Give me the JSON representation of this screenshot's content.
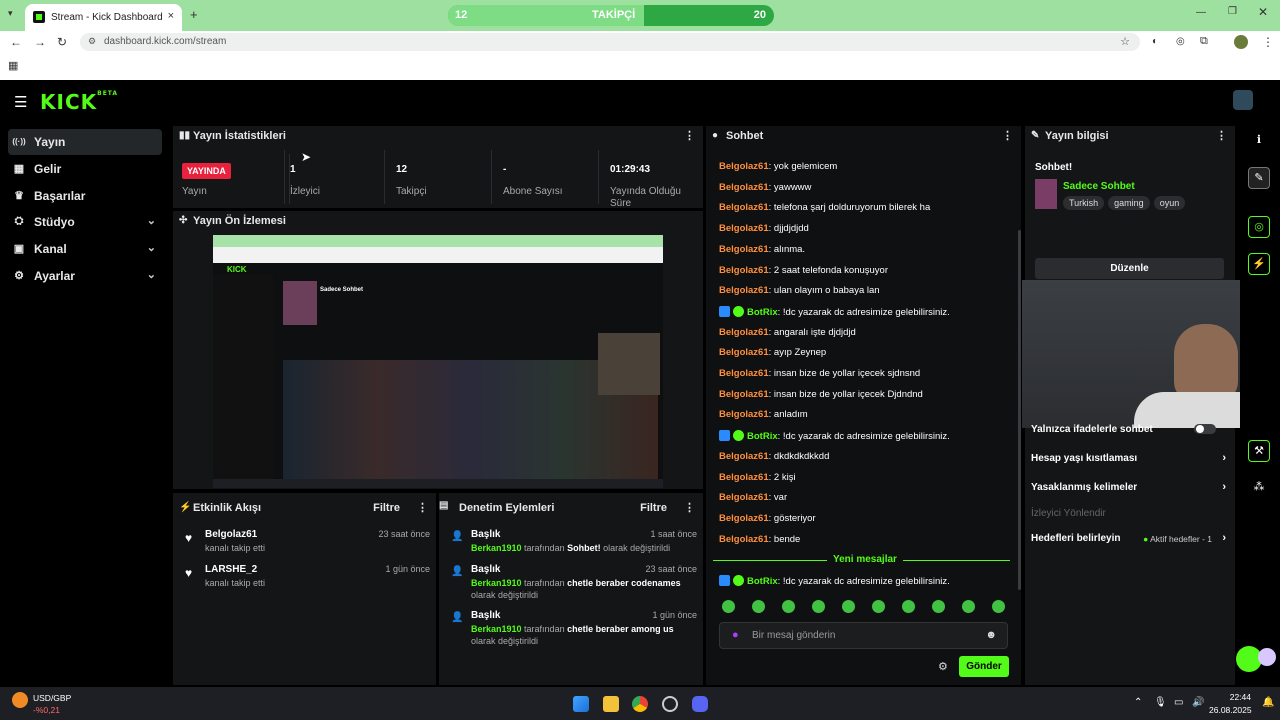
{
  "browser": {
    "tab_title": "Stream - Kick Dashboard",
    "url": "dashboard.kick.com/stream",
    "new_tab_glyph": "+",
    "close_glyph": "×"
  },
  "follower_goal": {
    "left_count": "12",
    "label": "TAKİPÇİ",
    "right_count": "20",
    "progress_fraction": 0.6,
    "color": "#2ea843"
  },
  "app": {
    "logo": "KICK",
    "logo_beta": "BETA",
    "accent": "#53fc18"
  },
  "sidebar": {
    "items": [
      {
        "label": "Yayın",
        "icon": "broadcast-icon",
        "glyph": "((·))",
        "active": true
      },
      {
        "label": "Gelir",
        "icon": "revenue-icon",
        "glyph": "▦"
      },
      {
        "label": "Başarılar",
        "icon": "trophy-icon",
        "glyph": "🏆"
      },
      {
        "label": "Stüdyo",
        "icon": "studio-icon",
        "glyph": "⛭",
        "expandable": true
      },
      {
        "label": "Kanal",
        "icon": "channel-icon",
        "glyph": "▣",
        "expandable": true
      },
      {
        "label": "Ayarlar",
        "icon": "settings-icon",
        "glyph": "⚙",
        "expandable": true
      }
    ]
  },
  "stats": {
    "title": "Yayın İstatistikleri",
    "live_badge": "YAYINDA",
    "live_label": "Yayın",
    "viewers_value": "1",
    "viewers_label": "İzleyici",
    "followers_value": "12",
    "followers_label": "Takipçi",
    "subs_value": "-",
    "subs_label": "Abone Sayısı",
    "uptime_value": "01:29:43",
    "uptime_label": "Yayında Olduğu Süre"
  },
  "preview": {
    "title": "Yayın Ön İzlemesi",
    "channel_name": "Sadece Sohbet"
  },
  "activity": {
    "title": "Etkinlik Akışı",
    "filter": "Filtre",
    "items": [
      {
        "name": "Belgolaz61",
        "text": "kanalı takip etti",
        "time": "23 saat önce"
      },
      {
        "name": "LARSHE_2",
        "text": "kanalı takip etti",
        "time": "1 gün önce"
      }
    ]
  },
  "moderation": {
    "title": "Denetim Eylemleri",
    "filter": "Filtre",
    "items": [
      {
        "title": "Başlık",
        "time": "1 saat önce",
        "user": "Berkan1910",
        "mid": " tarafından ",
        "value": "Sohbet!",
        "tail": " olarak değiştirildi"
      },
      {
        "title": "Başlık",
        "time": "23 saat önce",
        "user": "Berkan1910",
        "mid": " tarafından ",
        "value": "chetle beraber codenames",
        "tail": " olarak değiştirildi"
      },
      {
        "title": "Başlık",
        "time": "1 gün önce",
        "user": "Berkan1910",
        "mid": " tarafından ",
        "value": "chetle beraber among us",
        "tail": " olarak değiştirildi"
      }
    ]
  },
  "chat": {
    "title": "Sohbet",
    "messages": [
      {
        "user": "Belgolaz61",
        "text": ": yok gelemicem"
      },
      {
        "user": "Belgolaz61",
        "text": ": yawwww"
      },
      {
        "user": "Belgolaz61",
        "text": ": telefona şarj dolduruyorum bilerek ha"
      },
      {
        "user": "Belgolaz61",
        "text": ": djjdjdjdd"
      },
      {
        "user": "Belgolaz61",
        "text": ": alınma."
      },
      {
        "user": "Belgolaz61",
        "text": ": 2 saat telefonda konuşuyor"
      },
      {
        "user": "Belgolaz61",
        "text": ": ulan olayım o babaya lan"
      },
      {
        "user": "BotRix",
        "text": ": !dc yazarak dc adresimize gelebilirsiniz.",
        "bot": true
      },
      {
        "user": "Belgolaz61",
        "text": ": angaralı işte djdjdjd"
      },
      {
        "user": "Belgolaz61",
        "text": ": ayıp Zeynep"
      },
      {
        "user": "Belgolaz61",
        "text": ": insan bize de yollar içecek sjdnsnd"
      },
      {
        "user": "Belgolaz61",
        "text": ": insan bize de yollar içecek Djdndnd"
      },
      {
        "user": "Belgolaz61",
        "text": ": anladım"
      },
      {
        "user": "BotRix",
        "text": ": !dc yazarak dc adresimize gelebilirsiniz.",
        "bot": true
      },
      {
        "user": "Belgolaz61",
        "text": ": dkdkdkdkkdd"
      },
      {
        "user": "Belgolaz61",
        "text": ": 2 kişi"
      },
      {
        "user": "Belgolaz61",
        "text": ": var"
      },
      {
        "user": "Belgolaz61",
        "text": ": gösteriyor"
      },
      {
        "user": "Belgolaz61",
        "text": ": bende"
      }
    ],
    "new_messages": "Yeni mesajlar",
    "last_message": {
      "user": "BotRix",
      "text": ": !dc yazarak dc adresimize gelebilirsiniz."
    },
    "input_placeholder": "Bir mesaj gönderin",
    "send_label": "Gönder"
  },
  "info": {
    "title": "Yayın bilgisi",
    "stream_title": "Sohbet!",
    "category": "Sadece Sohbet",
    "tags": [
      "Turkish",
      "gaming",
      "oyun"
    ],
    "edit_label": "Düzenle",
    "settings": [
      {
        "label": "Yalnızca ifadelerle sohbet",
        "control": "toggle"
      },
      {
        "label": "Hesap yaşı kısıtlaması",
        "control": "chevron"
      },
      {
        "label": "Yasaklanmış kelimeler",
        "control": "chevron"
      },
      {
        "label": "İzleyici Yönlendir",
        "control": "none",
        "disabled": true
      },
      {
        "label": "Hedefleri belirleyin",
        "control": "chevron",
        "extra": "Aktif hedefler - 1"
      }
    ]
  },
  "taskbar": {
    "ticker_symbol": "USD/GBP",
    "ticker_change": "-%0,21",
    "time": "22:44",
    "date": "26.08.2025"
  }
}
